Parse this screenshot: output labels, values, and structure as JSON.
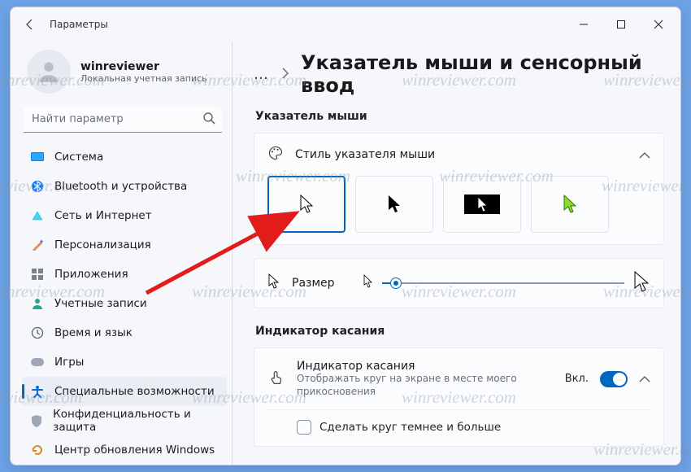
{
  "window": {
    "title": "Параметры"
  },
  "user": {
    "name": "winreviewer",
    "subtitle": "Локальная учетная запись"
  },
  "search": {
    "placeholder": "Найти параметр"
  },
  "nav": {
    "items": [
      {
        "label": "Система",
        "icon": "system"
      },
      {
        "label": "Bluetooth и устройства",
        "icon": "bluetooth"
      },
      {
        "label": "Сеть и Интернет",
        "icon": "network"
      },
      {
        "label": "Персонализация",
        "icon": "personalization"
      },
      {
        "label": "Приложения",
        "icon": "apps"
      },
      {
        "label": "Учетные записи",
        "icon": "accounts"
      },
      {
        "label": "Время и язык",
        "icon": "time"
      },
      {
        "label": "Игры",
        "icon": "gaming"
      },
      {
        "label": "Специальные возможности",
        "icon": "accessibility",
        "active": true
      },
      {
        "label": "Конфиденциальность и защита",
        "icon": "privacy"
      },
      {
        "label": "Центр обновления Windows",
        "icon": "update"
      }
    ]
  },
  "page": {
    "title": "Указатель мыши и сенсорный ввод",
    "section1": "Указатель мыши",
    "style_row": "Стиль указателя мыши",
    "size_label": "Размер",
    "section2": "Индикатор касания",
    "touch_title": "Индикатор касания",
    "touch_sub": "Отображать круг на экране в месте моего прикосновения",
    "touch_state": "Вкл.",
    "touch_option": "Сделать круг темнее и больше"
  },
  "watermark": "winreviewer.com"
}
